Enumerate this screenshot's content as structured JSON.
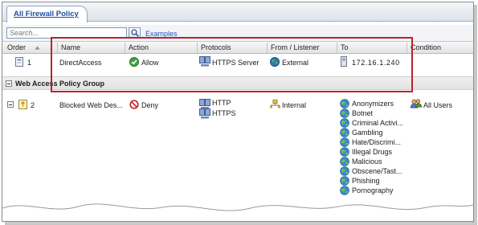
{
  "tabs": [
    {
      "label": "All Firewall Policy"
    }
  ],
  "search": {
    "placeholder": "Search...",
    "examples_label": "Examples"
  },
  "columns": [
    {
      "label": "Order",
      "sort": "ascending"
    },
    {
      "label": "Name"
    },
    {
      "label": "Action"
    },
    {
      "label": "Protocols"
    },
    {
      "label": "From / Listener"
    },
    {
      "label": "To"
    },
    {
      "label": "Condition"
    }
  ],
  "rows": [
    {
      "order": "1",
      "name": "DirectAccess",
      "action": {
        "label": "Allow",
        "icon": "allow-check-icon",
        "color": "#3ea33e"
      },
      "protocols": [
        "HTTPS Server"
      ],
      "from": {
        "label": "External",
        "icon": "globe-icon"
      },
      "to": [
        "172.16.1.240"
      ],
      "condition": []
    }
  ],
  "group": {
    "title": "Web Access Policy Group",
    "rows": [
      {
        "order": "2",
        "name": "Blocked Web Des...",
        "action": {
          "label": "Deny",
          "icon": "deny-icon",
          "color": "#c62828"
        },
        "protocols": [
          "HTTP",
          "HTTPS"
        ],
        "from": {
          "label": "Internal",
          "icon": "network-icon"
        },
        "to": [
          "Anonymizers",
          "Botnet",
          "Criminal Activi...",
          "Gambling",
          "Hate/Discrimi...",
          "Illegal Drugs",
          "Malicious",
          "Obscene/Tast...",
          "Phishing",
          "Pornography"
        ],
        "condition": [
          "All Users"
        ]
      }
    ]
  },
  "colors": {
    "tab_text": "#1f4fa0",
    "link": "#2155b8",
    "highlight_border": "#b8232f"
  }
}
